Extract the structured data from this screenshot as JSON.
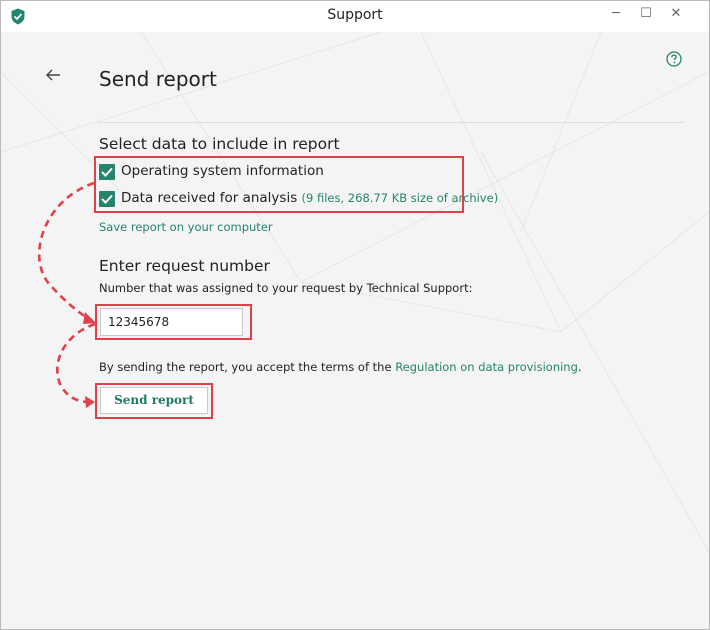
{
  "window": {
    "title": "Support",
    "controls": {
      "minimize": "─",
      "maximize": "☐",
      "close": "✕"
    }
  },
  "page": {
    "title": "Send report"
  },
  "data_section": {
    "title": "Select data to include in report",
    "options": [
      {
        "label": "Operating system information",
        "checked": true
      },
      {
        "label": "Data received for analysis",
        "detail": "(9 files, 268.77 KB size of archive)",
        "checked": true
      }
    ],
    "save_link": "Save report on your computer"
  },
  "request_section": {
    "title": "Enter request number",
    "hint": "Number that was assigned to your request by Technical Support:",
    "value": "12345678"
  },
  "terms": {
    "prefix": "By sending the report, you accept the terms of the ",
    "link": "Regulation on data provisioning",
    "suffix": "."
  },
  "send_button": "Send report",
  "colors": {
    "accent": "#25846d",
    "highlight": "#e0404a",
    "background": "#f4f4f4"
  },
  "icons": [
    "shield-app-icon",
    "help-icon",
    "back-arrow-icon",
    "checkmark-icon"
  ]
}
